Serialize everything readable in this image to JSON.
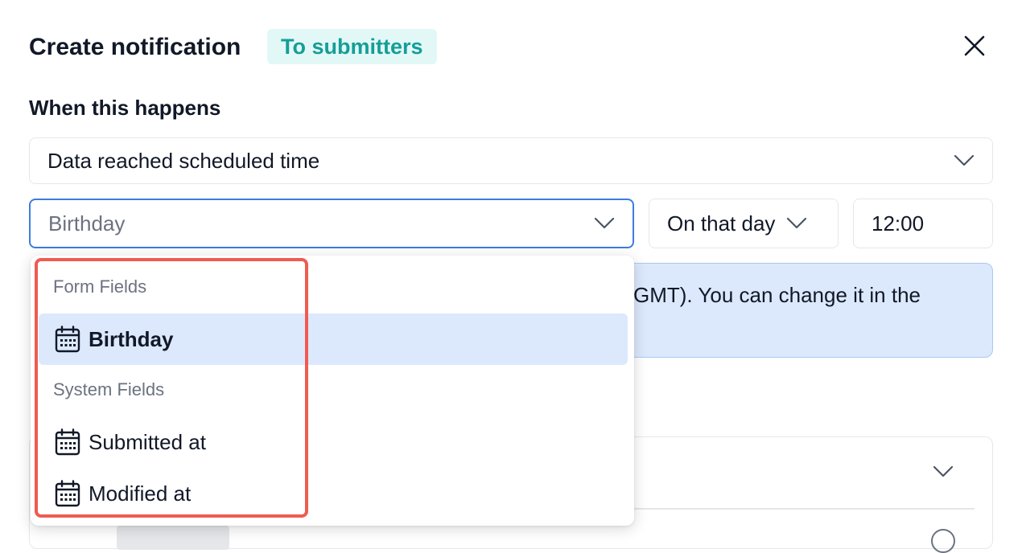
{
  "dialog": {
    "title": "Create notification",
    "audience_badge": "To submitters",
    "close_icon": "close-icon"
  },
  "trigger": {
    "section_label": "When this happens",
    "selected": "Data reached scheduled time"
  },
  "schedule": {
    "date_field_placeholder": "Birthday",
    "day_offset": "On that day",
    "time": "12:00"
  },
  "info_banner": {
    "visible_text": "GMT). You can change it in the"
  },
  "dropdown": {
    "groups": [
      {
        "label": "Form Fields",
        "options": [
          {
            "label": "Birthday",
            "icon": "calendar-icon",
            "selected": true
          }
        ]
      },
      {
        "label": "System Fields",
        "options": [
          {
            "label": "Submitted at",
            "icon": "calendar-icon",
            "selected": false
          },
          {
            "label": "Modified at",
            "icon": "calendar-icon",
            "selected": false
          }
        ]
      }
    ]
  },
  "colors": {
    "badge_bg": "#e2f8f7",
    "badge_text": "#159e97",
    "focus_border": "#3b7ddd",
    "info_bg": "#dce9fc",
    "selected_option_bg": "#dce9fc",
    "highlight_annotation": "#ef5b52"
  }
}
